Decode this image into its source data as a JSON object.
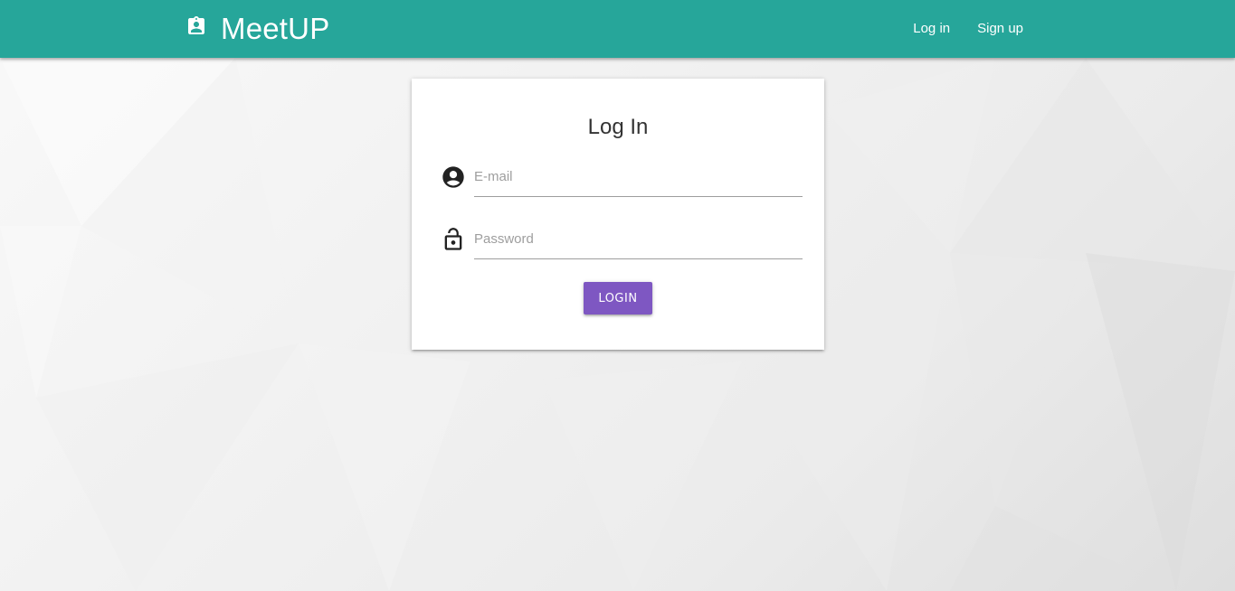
{
  "navbar": {
    "brand_icon": "badge-icon",
    "brand_text": "MeetUP",
    "links": [
      {
        "label": "Log in"
      },
      {
        "label": "Sign up"
      }
    ],
    "color": "#26a69a"
  },
  "login_card": {
    "title": "Log In",
    "email": {
      "icon": "account-circle-icon",
      "placeholder": "E-mail",
      "value": ""
    },
    "password": {
      "icon": "lock-open-icon",
      "placeholder": "Password",
      "value": ""
    },
    "submit_label": "LOGIN",
    "submit_color": "#7e57c2"
  }
}
